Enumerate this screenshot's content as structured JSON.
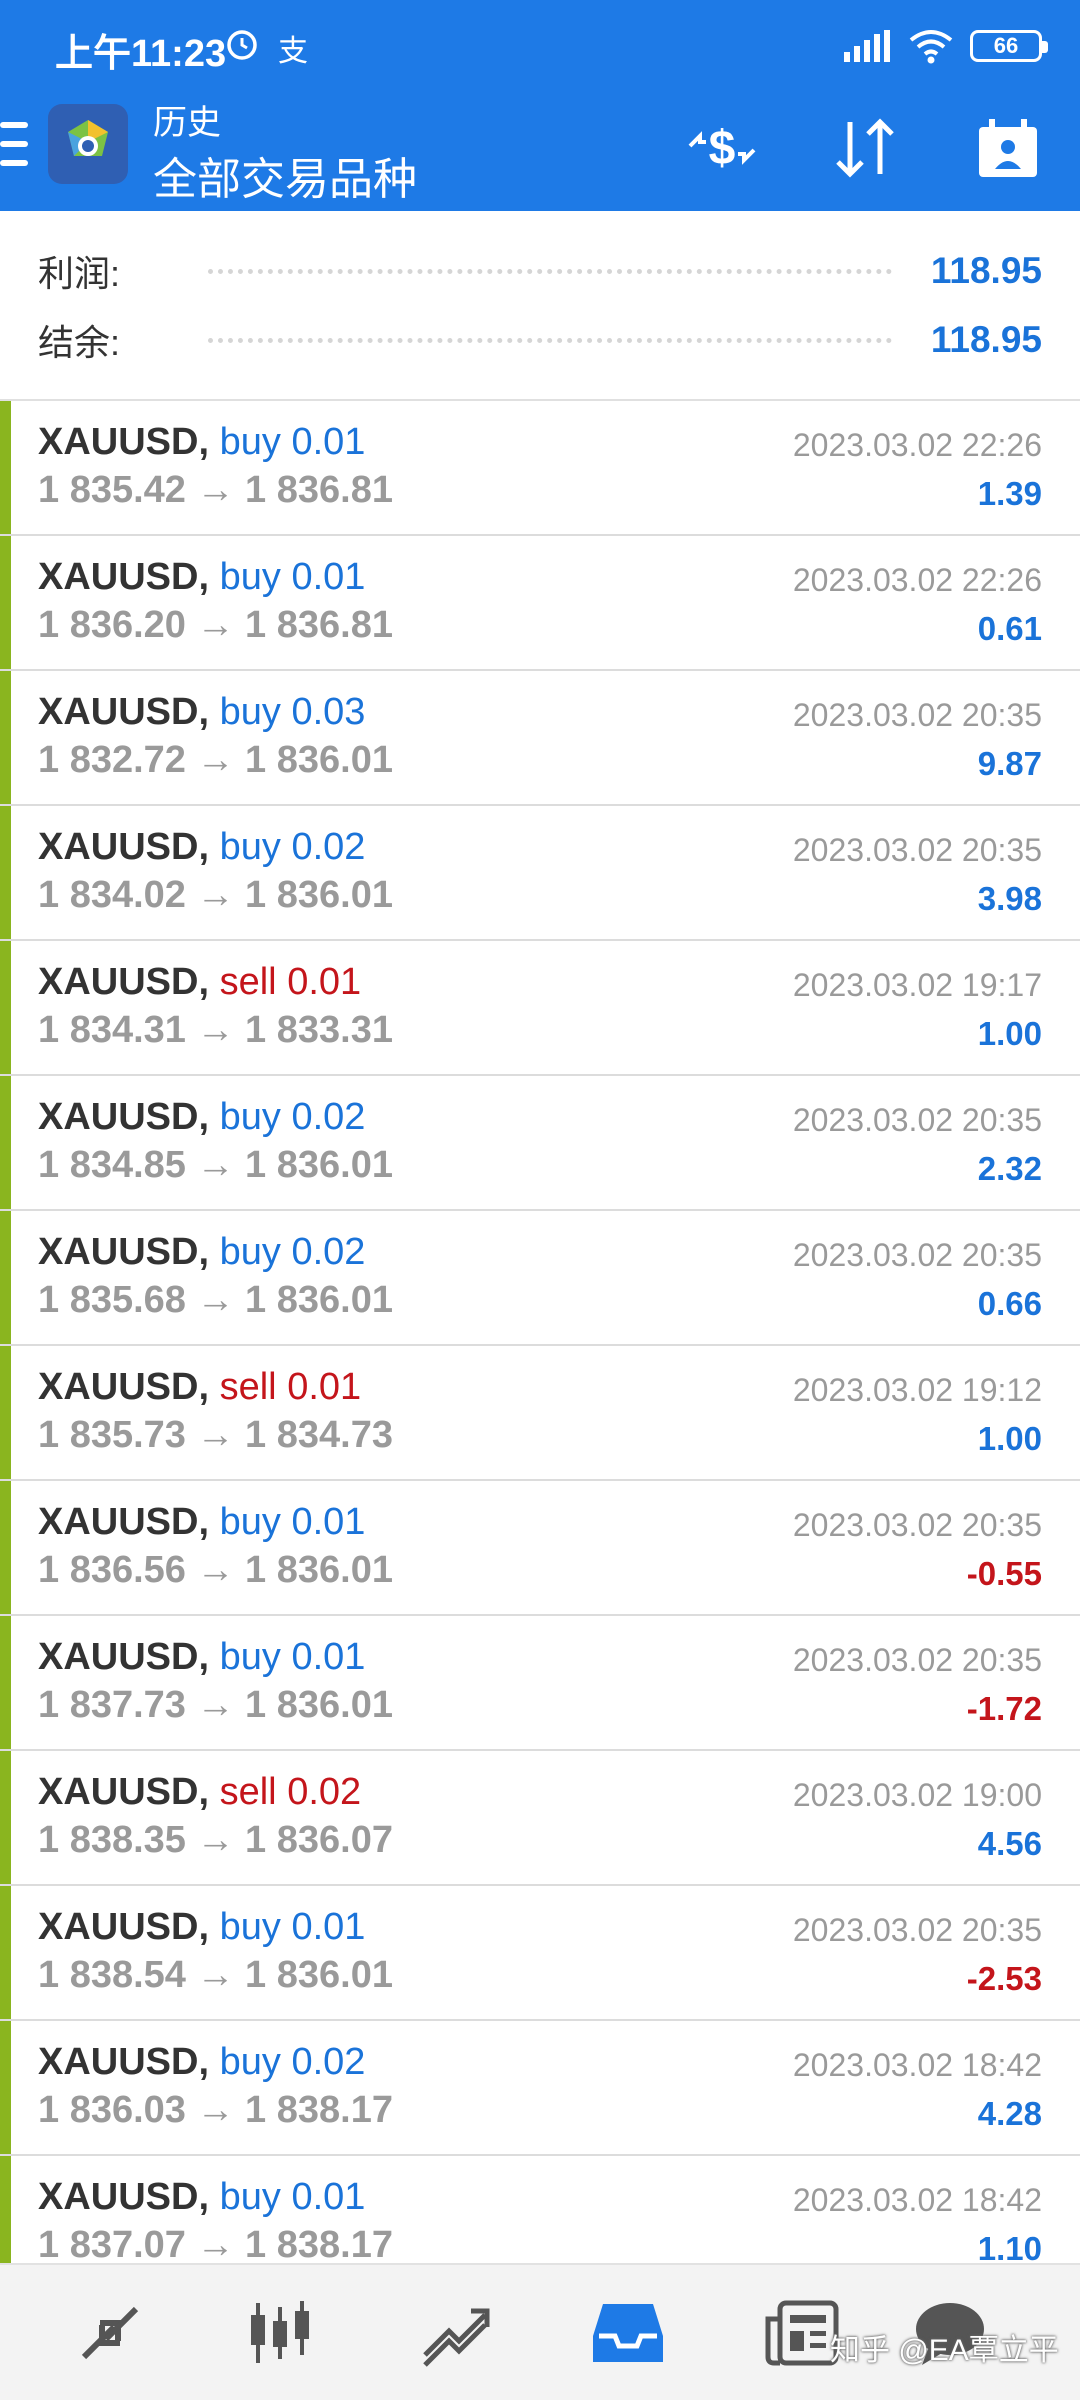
{
  "status_bar": {
    "time": "上午11:23",
    "extra_icon": "支",
    "battery": "66"
  },
  "header": {
    "subtitle": "历史",
    "title": "全部交易品种",
    "icons": [
      "currency-exchange-icon",
      "sort-icon",
      "calendar-icon"
    ]
  },
  "summary": {
    "profit_label": "利润:",
    "profit_value": "118.95",
    "balance_label": "结余:",
    "balance_value": "118.95"
  },
  "trades": [
    {
      "symbol": "XAUUSD,",
      "type": "buy",
      "volume": "0.01",
      "open": "1 835.42",
      "close": "1 836.81",
      "time": "2023.03.02 22:26",
      "profit": "1.39"
    },
    {
      "symbol": "XAUUSD,",
      "type": "buy",
      "volume": "0.01",
      "open": "1 836.20",
      "close": "1 836.81",
      "time": "2023.03.02 22:26",
      "profit": "0.61"
    },
    {
      "symbol": "XAUUSD,",
      "type": "buy",
      "volume": "0.03",
      "open": "1 832.72",
      "close": "1 836.01",
      "time": "2023.03.02 20:35",
      "profit": "9.87"
    },
    {
      "symbol": "XAUUSD,",
      "type": "buy",
      "volume": "0.02",
      "open": "1 834.02",
      "close": "1 836.01",
      "time": "2023.03.02 20:35",
      "profit": "3.98"
    },
    {
      "symbol": "XAUUSD,",
      "type": "sell",
      "volume": "0.01",
      "open": "1 834.31",
      "close": "1 833.31",
      "time": "2023.03.02 19:17",
      "profit": "1.00"
    },
    {
      "symbol": "XAUUSD,",
      "type": "buy",
      "volume": "0.02",
      "open": "1 834.85",
      "close": "1 836.01",
      "time": "2023.03.02 20:35",
      "profit": "2.32"
    },
    {
      "symbol": "XAUUSD,",
      "type": "buy",
      "volume": "0.02",
      "open": "1 835.68",
      "close": "1 836.01",
      "time": "2023.03.02 20:35",
      "profit": "0.66"
    },
    {
      "symbol": "XAUUSD,",
      "type": "sell",
      "volume": "0.01",
      "open": "1 835.73",
      "close": "1 834.73",
      "time": "2023.03.02 19:12",
      "profit": "1.00"
    },
    {
      "symbol": "XAUUSD,",
      "type": "buy",
      "volume": "0.01",
      "open": "1 836.56",
      "close": "1 836.01",
      "time": "2023.03.02 20:35",
      "profit": "-0.55"
    },
    {
      "symbol": "XAUUSD,",
      "type": "buy",
      "volume": "0.01",
      "open": "1 837.73",
      "close": "1 836.01",
      "time": "2023.03.02 20:35",
      "profit": "-1.72"
    },
    {
      "symbol": "XAUUSD,",
      "type": "sell",
      "volume": "0.02",
      "open": "1 838.35",
      "close": "1 836.07",
      "time": "2023.03.02 19:00",
      "profit": "4.56"
    },
    {
      "symbol": "XAUUSD,",
      "type": "buy",
      "volume": "0.01",
      "open": "1 838.54",
      "close": "1 836.01",
      "time": "2023.03.02 20:35",
      "profit": "-2.53"
    },
    {
      "symbol": "XAUUSD,",
      "type": "buy",
      "volume": "0.02",
      "open": "1 836.03",
      "close": "1 838.17",
      "time": "2023.03.02 18:42",
      "profit": "4.28"
    },
    {
      "symbol": "XAUUSD,",
      "type": "buy",
      "volume": "0.01",
      "open": "1 837.07",
      "close": "1 838.17",
      "time": "2023.03.02 18:42",
      "profit": "1.10"
    }
  ],
  "bottom_nav": {
    "items": [
      "quotes-icon",
      "chart-icon",
      "trade-icon",
      "history-icon",
      "news-icon",
      "chat-icon"
    ],
    "active": "history-icon"
  },
  "watermark": "知乎 @EA覃立平",
  "colors": {
    "header_bg": "#1e7ae6",
    "buy": "#1a73d9",
    "sell": "#c4151b",
    "trade_bar": "#8ab51f"
  }
}
